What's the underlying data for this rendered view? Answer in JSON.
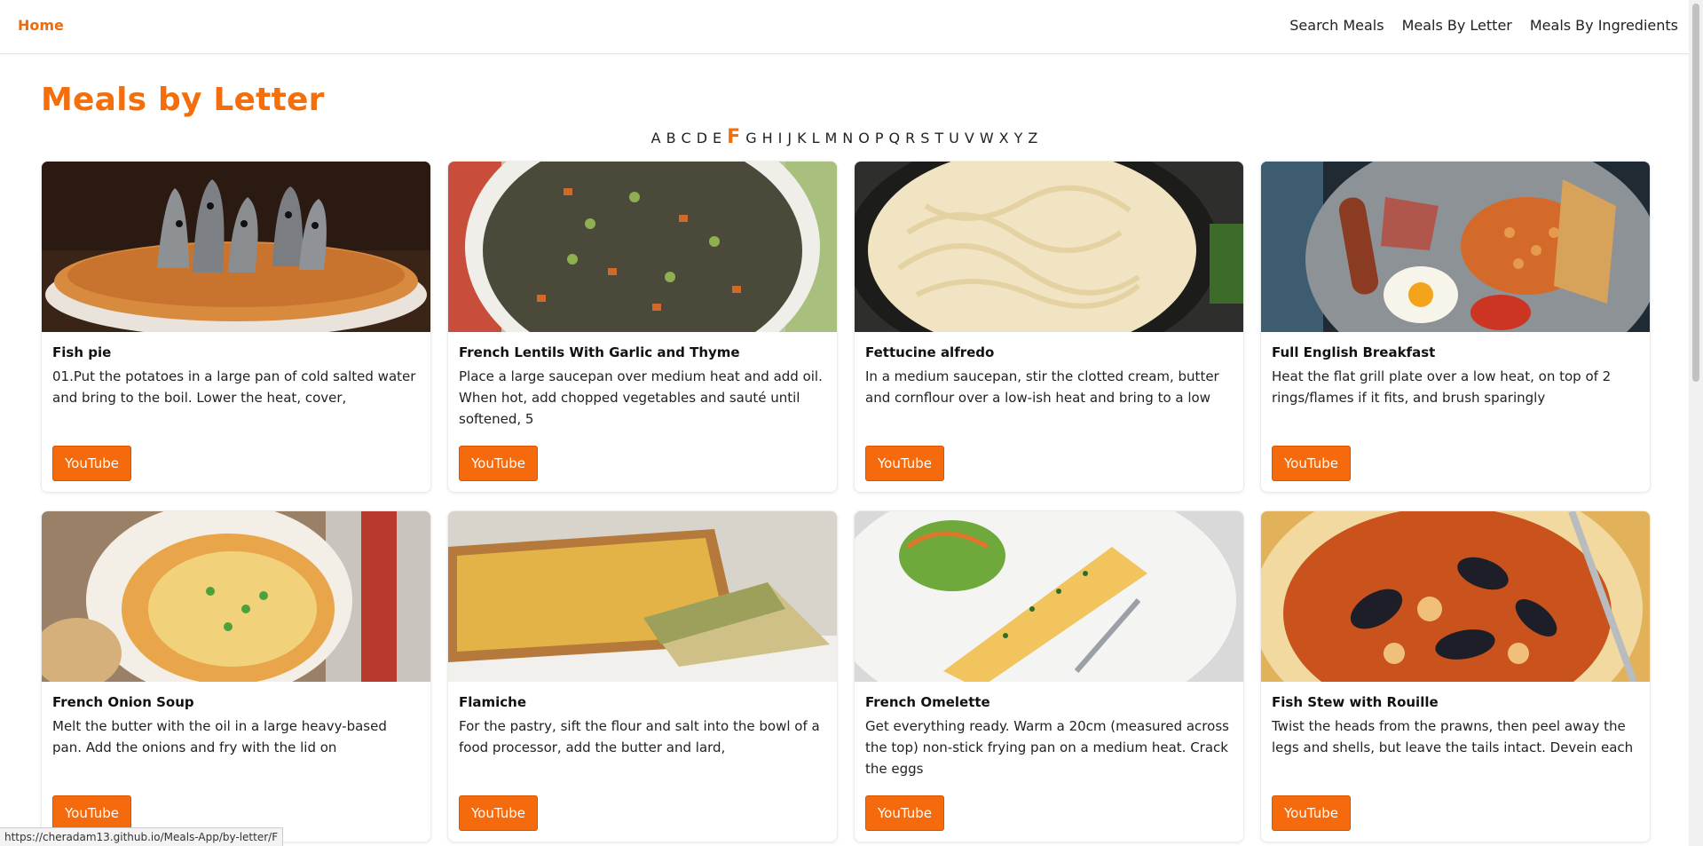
{
  "nav": {
    "home": "Home",
    "links": [
      "Search Meals",
      "Meals By Letter",
      "Meals By Ingredients"
    ]
  },
  "page": {
    "title": "Meals by Letter",
    "letters": [
      "A",
      "B",
      "C",
      "D",
      "E",
      "F",
      "G",
      "H",
      "I",
      "J",
      "K",
      "L",
      "M",
      "N",
      "O",
      "P",
      "Q",
      "R",
      "S",
      "T",
      "U",
      "V",
      "W",
      "X",
      "Y",
      "Z"
    ],
    "active_letter": "F"
  },
  "meals": [
    {
      "name": "Fish pie",
      "desc": "01.Put the potatoes in a large pan of cold salted water and bring to the boil. Lower the heat, cover,",
      "button": "YouTube",
      "image": "fish-pie-photo"
    },
    {
      "name": "French Lentils With Garlic and Thyme",
      "desc": "Place a large saucepan over medium heat and add oil. When hot, add chopped vegetables and sauté until softened, 5",
      "button": "YouTube",
      "image": "lentils-photo"
    },
    {
      "name": "Fettucine alfredo",
      "desc": "In a medium saucepan, stir the clotted cream, butter and cornflour over a low-ish heat and bring to a low",
      "button": "YouTube",
      "image": "fettucine-photo"
    },
    {
      "name": "Full English Breakfast",
      "desc": "Heat the flat grill plate over a low heat, on top of 2 rings/flames if it fits, and brush sparingly",
      "button": "YouTube",
      "image": "breakfast-photo"
    },
    {
      "name": "French Onion Soup",
      "desc": "Melt the butter with the oil in a large heavy-based pan. Add the onions and fry with the lid on",
      "button": "YouTube",
      "image": "onion-soup-photo"
    },
    {
      "name": "Flamiche",
      "desc": "For the pastry, sift the flour and salt into the bowl of a food processor, add the butter and lard,",
      "button": "YouTube",
      "image": "flamiche-photo"
    },
    {
      "name": "French Omelette",
      "desc": "Get everything ready. Warm a 20cm (measured across the top) non-stick frying pan on a medium heat. Crack the eggs",
      "button": "YouTube",
      "image": "omelette-photo"
    },
    {
      "name": "Fish Stew with Rouille",
      "desc": "Twist the heads from the prawns, then peel away the legs and shells, but leave the tails intact. Devein each",
      "button": "YouTube",
      "image": "fish-stew-photo"
    }
  ],
  "status_url": "https://cheradam13.github.io/Meals-App/by-letter/F",
  "colors": {
    "accent": "#f46f0c",
    "button": "#f46a0c"
  }
}
